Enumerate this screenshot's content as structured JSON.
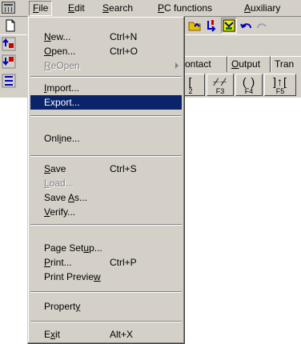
{
  "menubar": {
    "items": [
      {
        "label": "File",
        "mnemonic": "F",
        "rest": "ile"
      },
      {
        "label": "Edit",
        "mnemonic": "E",
        "rest": "dit"
      },
      {
        "label": "Search",
        "mnemonic": "S",
        "rest": "earch"
      },
      {
        "label": "PC functions",
        "mnemonic": "P",
        "rest": "C functions"
      },
      {
        "label": "Auxiliary",
        "mnemonic": "A",
        "rest": "uxiliary"
      }
    ]
  },
  "tabs": [
    {
      "label": "ontact",
      "mnemonic": "",
      "rest": "ontact"
    },
    {
      "label": "Output",
      "mnemonic": "O",
      "rest": "utput"
    },
    {
      "label": "Tran",
      "mnemonic": "",
      "rest": "Tran"
    }
  ],
  "function_keys": [
    {
      "symbol": "[",
      "label": "2"
    },
    {
      "symbol": "⌿⌿",
      "label": "F3"
    },
    {
      "symbol": "( )",
      "label": "F4"
    },
    {
      "symbol": "]↑[",
      "label": "F5"
    }
  ],
  "file_menu": {
    "new": {
      "pre": "",
      "mn": "N",
      "post": "ew...",
      "shortcut": "Ctrl+N"
    },
    "open": {
      "pre": "",
      "mn": "O",
      "post": "pen...",
      "shortcut": "Ctrl+O"
    },
    "reopen": {
      "pre": "",
      "mn": "R",
      "post": "eOpen"
    },
    "import": {
      "pre": "",
      "mn": "I",
      "post": "mport..."
    },
    "export": {
      "pre": "Export...",
      "mn": "",
      "post": ""
    },
    "online": {
      "pre": "Onl",
      "mn": "i",
      "post": "ne..."
    },
    "save": {
      "pre": "",
      "mn": "S",
      "post": "ave",
      "shortcut": "Ctrl+S"
    },
    "load": {
      "pre": "",
      "mn": "L",
      "post": "oad..."
    },
    "save_as": {
      "pre": "Save ",
      "mn": "A",
      "post": "s..."
    },
    "verify": {
      "pre": "",
      "mn": "V",
      "post": "erify..."
    },
    "page_setup": {
      "pre": "Page Set",
      "mn": "u",
      "post": "p..."
    },
    "print": {
      "pre": "",
      "mn": "P",
      "post": "rint...",
      "shortcut": "Ctrl+P"
    },
    "print_preview": {
      "pre": "Print Previe",
      "mn": "w",
      "post": ""
    },
    "property": {
      "pre": "Propert",
      "mn": "y",
      "post": ""
    },
    "exit": {
      "pre": "E",
      "mn": "x",
      "post": "it",
      "shortcut": "Alt+X"
    }
  },
  "colors": {
    "face": "#d4d0c8",
    "highlight": "#0a246a",
    "disabled": "#808080"
  }
}
